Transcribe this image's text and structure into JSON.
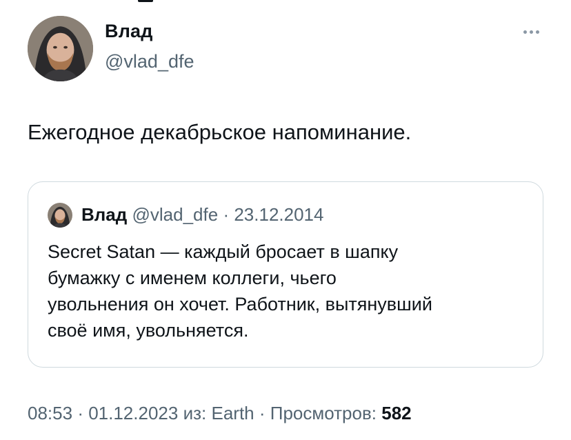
{
  "tweet": {
    "author_name": "Влад",
    "author_handle": "@vlad_dfe",
    "text": "Ежегодное декабрьское напоминание."
  },
  "quoted_tweet": {
    "author_name": "Влад",
    "author_handle": "@vlad_dfe",
    "separator": "·",
    "date": "23.12.2014",
    "text_lines": [
      "Secret Satan — каждый бросает в шапку",
      "бумажку с именем коллеги, чьего",
      "увольнения он хочет. Работник, вытянувший",
      "своё имя, увольняется."
    ]
  },
  "meta": {
    "time": "08:53",
    "date": "01.12.2023",
    "source_prefix": "из:",
    "source": "Earth",
    "views_label": "Просмотров:",
    "views_count": "582"
  },
  "icons": {
    "more": "more-horizontal-icon",
    "avatar": "profile-photo",
    "quote_avatar": "profile-photo"
  },
  "colors": {
    "text_primary": "#0f1419",
    "text_secondary": "#536471",
    "border": "#cfd9de",
    "more_dots": "#8b98a5"
  }
}
